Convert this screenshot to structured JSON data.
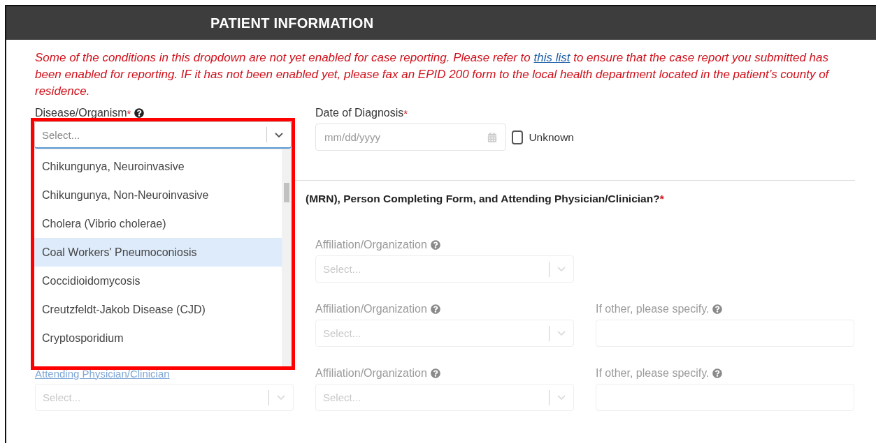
{
  "header": {
    "title": "PATIENT INFORMATION"
  },
  "notice": {
    "before": "Some of the conditions in this dropdown are not yet enabled for case reporting. Please refer to",
    "link": "this list",
    "after": "to ensure that the case report you submitted has been enabled for reporting. IF it has not been enabled yet, please fax an EPID 200 form to the local health department located in the patient’s county of residence."
  },
  "disease_field": {
    "label": "Disease/Organism",
    "required_mark": "*",
    "placeholder": "Select...",
    "expanded": true,
    "options": [
      {
        "label": "Chikungunya, Neuroinvasive",
        "selected": false
      },
      {
        "label": "Chikungunya, Non-Neuroinvasive",
        "selected": false
      },
      {
        "label": "Cholera (Vibrio cholerae)",
        "selected": false
      },
      {
        "label": "Coal Workers' Pneumoconiosis",
        "selected": true
      },
      {
        "label": "Coccidioidomycosis",
        "selected": false
      },
      {
        "label": "Creutzfeldt-Jakob Disease (CJD)",
        "selected": false
      },
      {
        "label": "Cryptosporidium",
        "selected": false
      }
    ]
  },
  "date_field": {
    "label": "Date of Diagnosis",
    "required_mark": "*",
    "placeholder": "mm/dd/yyyy"
  },
  "unknown_checkbox": {
    "label": "Unknown",
    "checked": false
  },
  "question": {
    "text": "(MRN), Person Completing Form, and Attending Physician/Clinician?",
    "required_mark": "*"
  },
  "rows": [
    {
      "affiliation": {
        "label": "Affiliation/Organization",
        "placeholder": "Select...",
        "disabled": true
      }
    },
    {
      "affiliation": {
        "label": "Affiliation/Organization",
        "placeholder": "Select...",
        "disabled": true
      },
      "other": {
        "label": "If other, please specify.",
        "disabled": true
      }
    },
    {
      "person": {
        "label": "Attending Physician/Clinician",
        "placeholder": "Select...",
        "disabled": true
      },
      "affiliation": {
        "label": "Affiliation/Organization",
        "placeholder": "Select...",
        "disabled": true
      },
      "other": {
        "label": "If other, please specify.",
        "disabled": true
      }
    }
  ]
}
